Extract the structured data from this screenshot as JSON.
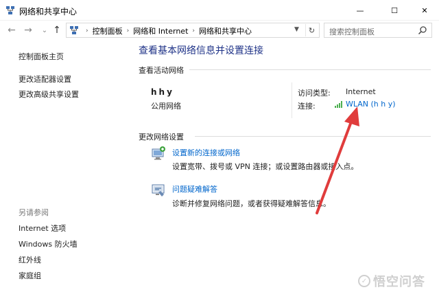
{
  "window": {
    "title": "网络和共享中心",
    "minimize_glyph": "—",
    "maximize_glyph": "☐",
    "close_glyph": "✕"
  },
  "nav": {
    "back_glyph": "←",
    "forward_glyph": "→",
    "history_glyph": "⌄",
    "up_glyph": "↑",
    "breadcrumbs": [
      "控制面板",
      "网络和 Internet",
      "网络和共享中心"
    ],
    "separator": "›",
    "refresh_glyph": "↻",
    "search_placeholder": "搜索控制面板"
  },
  "left_pane": {
    "links": [
      "控制面板主页",
      "更改适配器设置",
      "更改高级共享设置"
    ],
    "see_also_heading": "另请参阅",
    "see_also": [
      "Internet 选项",
      "Windows 防火墙",
      "红外线",
      "家庭组"
    ]
  },
  "main": {
    "title": "查看基本网络信息并设置连接",
    "active_section": "查看活动网络",
    "network": {
      "name": "hhy",
      "category": "公用网络",
      "access_type_label": "访问类型:",
      "access_type_value": "Internet",
      "connection_label": "连接:",
      "connection_value": "WLAN (h h y)"
    },
    "change_section": "更改网络设置",
    "tasks": [
      {
        "title": "设置新的连接或网络",
        "desc": "设置宽带、拨号或 VPN 连接；或设置路由器或接入点。",
        "icon": "network-setup-icon"
      },
      {
        "title": "问题疑难解答",
        "desc": "诊断并修复网络问题，或者获得疑难解答信息。",
        "icon": "troubleshoot-icon"
      }
    ]
  },
  "annotation_color": "#e03c3c",
  "watermark": "悟空问答"
}
